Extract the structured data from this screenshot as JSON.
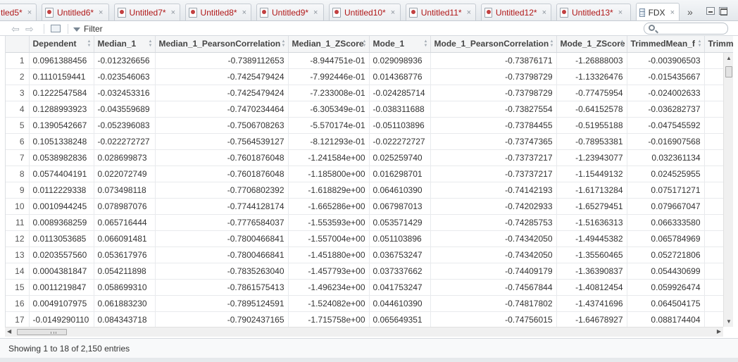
{
  "tabs": [
    {
      "label": "tled5*",
      "close": "×"
    },
    {
      "label": "Untitled6*",
      "close": "×"
    },
    {
      "label": "Untitled7*",
      "close": "×"
    },
    {
      "label": "Untitled8*",
      "close": "×"
    },
    {
      "label": "Untitled9*",
      "close": "×"
    },
    {
      "label": "Untitled10*",
      "close": "×"
    },
    {
      "label": "Untitled11*",
      "close": "×"
    },
    {
      "label": "Untitled12*",
      "close": "×"
    },
    {
      "label": "Untitled13*",
      "close": "×"
    },
    {
      "label": "FDX",
      "close": "×",
      "active": true
    }
  ],
  "tab_overflow": "»",
  "toolbar": {
    "back_icon": "⇦",
    "forward_icon": "⇨",
    "filter_label": "Filter",
    "search_placeholder": ""
  },
  "table": {
    "columns": [
      "Dependent",
      "Median_1",
      "Median_1_PearsonCorrelation",
      "Median_1_ZScore",
      "Mode_1",
      "Mode_1_PearsonCorrelation",
      "Mode_1_ZScore",
      "TrimmedMean_f",
      "Trimm"
    ],
    "rows": [
      [
        "1",
        "0.0961388456",
        "-0.012326656",
        "-0.7389112653",
        "-8.944751e-01",
        "0.029098936",
        "-0.73876171",
        "-1.26888003",
        "-0.003906503"
      ],
      [
        "2",
        "0.1110159441",
        "-0.023546063",
        "-0.7425479424",
        "-7.992446e-01",
        "0.014368776",
        "-0.73798729",
        "-1.13326476",
        "-0.015435667"
      ],
      [
        "3",
        "0.1222547584",
        "-0.032453316",
        "-0.7425479424",
        "-7.233008e-01",
        "-0.024285714",
        "-0.73798729",
        "-0.77475954",
        "-0.024002633"
      ],
      [
        "4",
        "0.1288993923",
        "-0.043559689",
        "-0.7470234464",
        "-6.305349e-01",
        "-0.038311688",
        "-0.73827554",
        "-0.64152578",
        "-0.036282737"
      ],
      [
        "5",
        "0.1390542667",
        "-0.052396083",
        "-0.7506708263",
        "-5.570174e-01",
        "-0.051103896",
        "-0.73784455",
        "-0.51955188",
        "-0.047545592"
      ],
      [
        "6",
        "0.1051338248",
        "-0.022272727",
        "-0.7564539127",
        "-8.121293e-01",
        "-0.022272727",
        "-0.73747365",
        "-0.78953381",
        "-0.016907568"
      ],
      [
        "7",
        "0.0538982836",
        "0.028699873",
        "-0.7601876048",
        "-1.241584e+00",
        "0.025259740",
        "-0.73737217",
        "-1.23943077",
        "0.032361134"
      ],
      [
        "8",
        "0.0574404191",
        "0.022072749",
        "-0.7601876048",
        "-1.185800e+00",
        "0.016298701",
        "-0.73737217",
        "-1.15449132",
        "0.024525955"
      ],
      [
        "9",
        "0.0112229338",
        "0.073498118",
        "-0.7706802392",
        "-1.618829e+00",
        "0.064610390",
        "-0.74142193",
        "-1.61713284",
        "0.075171271"
      ],
      [
        "10",
        "0.0010944245",
        "0.078987076",
        "-0.7744128174",
        "-1.665286e+00",
        "0.067987013",
        "-0.74202933",
        "-1.65279451",
        "0.079667047"
      ],
      [
        "11",
        "0.0089368259",
        "0.065716444",
        "-0.7776584037",
        "-1.553593e+00",
        "0.053571429",
        "-0.74285753",
        "-1.51636313",
        "0.066333580"
      ],
      [
        "12",
        "0.0113053685",
        "0.066091481",
        "-0.7800466841",
        "-1.557004e+00",
        "0.051103896",
        "-0.74342050",
        "-1.49445382",
        "0.065784969"
      ],
      [
        "13",
        "0.0203557560",
        "0.053617976",
        "-0.7800466841",
        "-1.451880e+00",
        "0.036753247",
        "-0.74342050",
        "-1.35560465",
        "0.052721806"
      ],
      [
        "14",
        "0.0004381847",
        "0.054211898",
        "-0.7835263040",
        "-1.457793e+00",
        "0.037337662",
        "-0.74409179",
        "-1.36390837",
        "0.054430699"
      ],
      [
        "15",
        "0.0011219847",
        "0.058699310",
        "-0.7861575413",
        "-1.496234e+00",
        "0.041753247",
        "-0.74567844",
        "-1.40812454",
        "0.059926474"
      ],
      [
        "16",
        "0.0049107975",
        "0.061883230",
        "-0.7895124591",
        "-1.524082e+00",
        "0.044610390",
        "-0.74817802",
        "-1.43741696",
        "0.064504175"
      ],
      [
        "17",
        "-0.0149290110",
        "0.084343718",
        "-0.7902437165",
        "-1.715758e+00",
        "0.065649351",
        "-0.74756015",
        "-1.64678927",
        "0.088174404"
      ]
    ]
  },
  "status": {
    "text": "Showing 1 to 18 of 2,150 entries"
  }
}
